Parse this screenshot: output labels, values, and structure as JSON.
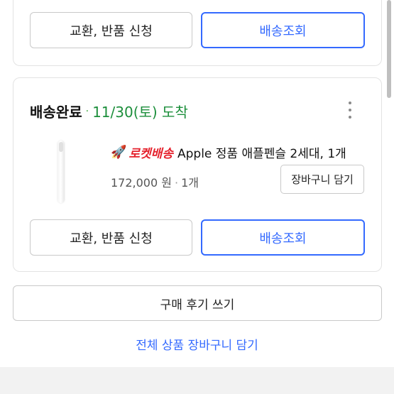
{
  "top_card": {
    "exchange_button": "교환, 반품 신청",
    "tracking_button": "배송조회"
  },
  "order": {
    "status": "배송완료",
    "separator": "·",
    "arrival": "11/30(토) 도착",
    "more_icon": "more-vertical-icon",
    "product": {
      "rocket_icon": "🚀",
      "badge": "로켓배송",
      "title": "Apple 정품 애플펜슬 2세대, 1개",
      "price": "172,000 원",
      "price_separator": "·",
      "quantity": "1개",
      "add_to_cart": "장바구니 담기"
    },
    "exchange_button": "교환, 반품 신청",
    "tracking_button": "배송조회"
  },
  "review_button": "구매 후기 쓰기",
  "all_to_cart": "전체 상품 장바구니 담기",
  "colors": {
    "accent_blue": "#346aff",
    "arrival_green": "#1d8f3c",
    "rocket_red": "#e5222d"
  }
}
